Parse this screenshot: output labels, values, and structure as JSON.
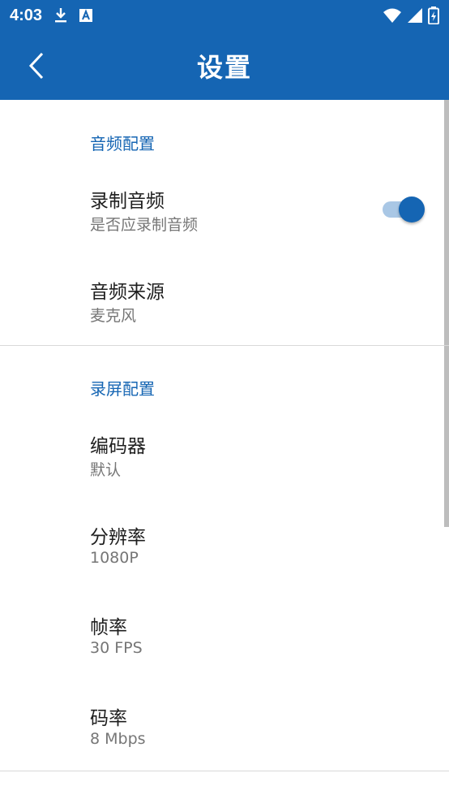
{
  "status_bar": {
    "time": "4:03",
    "icons_left": [
      "download-icon",
      "font-icon"
    ],
    "icons_right": [
      "wifi-icon",
      "signal-icon",
      "battery-icon"
    ]
  },
  "toolbar": {
    "title": "设置",
    "back_icon": "back-arrow-icon"
  },
  "colors": {
    "primary": "#1565b3",
    "switch_track_on": "#a9c7e5",
    "title_text": "#1f1f1f",
    "summary_text": "#767676",
    "divider": "#d9d9d9"
  },
  "sections": {
    "audio": {
      "header": "音频配置",
      "record_audio": {
        "title": "录制音频",
        "summary": "是否应录制音频",
        "enabled": true
      },
      "audio_source": {
        "title": "音频来源",
        "summary": "麦克风"
      }
    },
    "screen": {
      "header": "录屏配置",
      "encoder": {
        "title": "编码器",
        "summary": "默认"
      },
      "resolution": {
        "title": "分辨率",
        "summary": "1080P"
      },
      "frame_rate": {
        "title": "帧率",
        "summary": "30 FPS"
      },
      "bitrate": {
        "title": "码率",
        "summary": "8 Mbps"
      }
    }
  }
}
